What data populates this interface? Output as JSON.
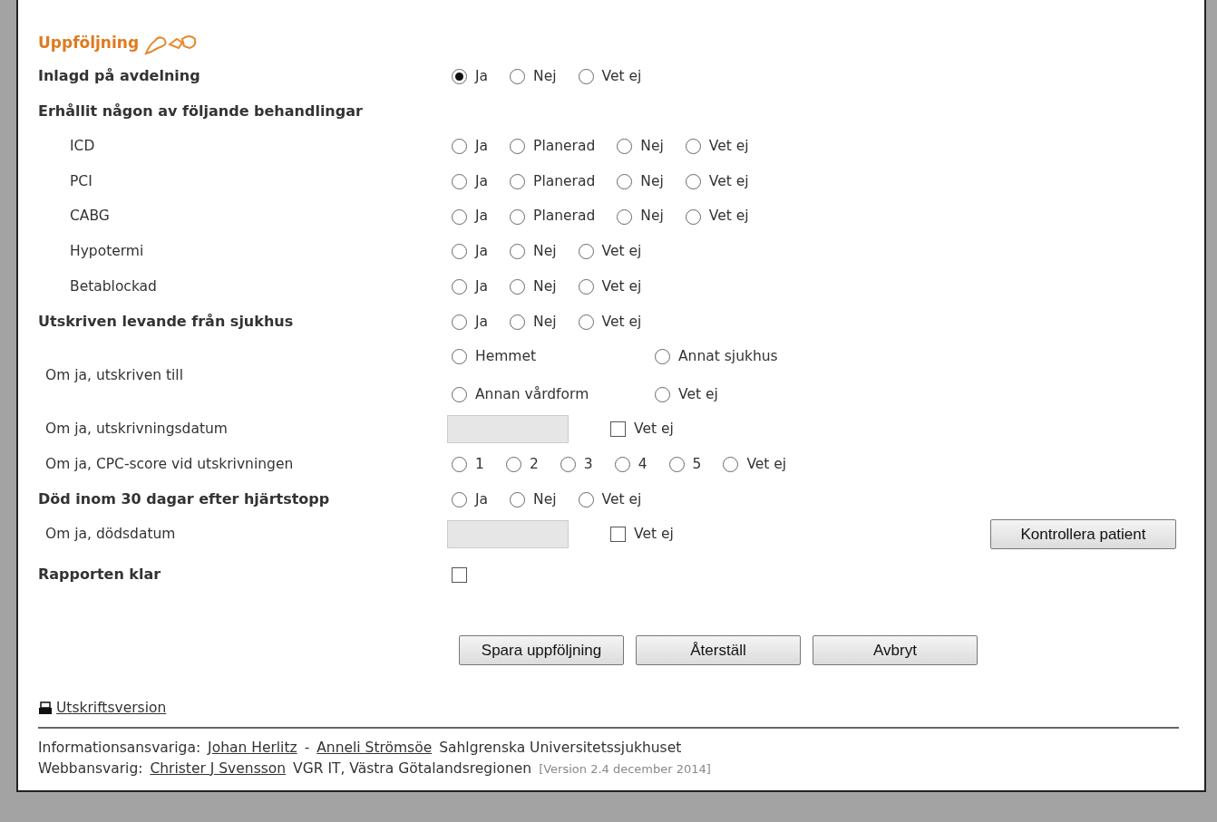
{
  "title": "Uppföljning",
  "questions": [
    {
      "kind": "radio",
      "label": "Inlagd på avdelning",
      "options": [
        {
          "label": "Ja",
          "selected": true
        },
        {
          "label": "Nej",
          "selected": false
        },
        {
          "label": "Vet ej",
          "selected": false
        }
      ]
    },
    {
      "kind": "section",
      "label": "Erhållit någon av följande behandlingar",
      "children": [
        {
          "kind": "radio",
          "label": "ICD",
          "options": [
            {
              "label": "Ja",
              "selected": false
            },
            {
              "label": "Planerad",
              "selected": false
            },
            {
              "label": "Nej",
              "selected": false
            },
            {
              "label": "Vet ej",
              "selected": false
            }
          ]
        },
        {
          "kind": "radio",
          "label": "PCI",
          "options": [
            {
              "label": "Ja",
              "selected": false
            },
            {
              "label": "Planerad",
              "selected": false
            },
            {
              "label": "Nej",
              "selected": false
            },
            {
              "label": "Vet ej",
              "selected": false
            }
          ]
        },
        {
          "kind": "radio",
          "label": "CABG",
          "options": [
            {
              "label": "Ja",
              "selected": false
            },
            {
              "label": "Planerad",
              "selected": false
            },
            {
              "label": "Nej",
              "selected": false
            },
            {
              "label": "Vet ej",
              "selected": false
            }
          ]
        },
        {
          "kind": "radio",
          "label": "Hypotermi",
          "options": [
            {
              "label": "Ja",
              "selected": false
            },
            {
              "label": "Nej",
              "selected": false
            },
            {
              "label": "Vet ej",
              "selected": false
            }
          ]
        },
        {
          "kind": "radio",
          "label": "Betablockad",
          "options": [
            {
              "label": "Ja",
              "selected": false
            },
            {
              "label": "Nej",
              "selected": false
            },
            {
              "label": "Vet ej",
              "selected": false
            }
          ]
        }
      ]
    },
    {
      "kind": "radio",
      "label": "Utskriven levande från sjukhus",
      "options": [
        {
          "label": "Ja",
          "selected": false
        },
        {
          "label": "Nej",
          "selected": false
        },
        {
          "label": "Vet ej",
          "selected": false
        }
      ],
      "children": [
        {
          "kind": "grid",
          "label": "Om ja, utskriven till",
          "options": [
            {
              "label": "Hemmet",
              "selected": false
            },
            {
              "label": "Annat sjukhus",
              "selected": false
            },
            {
              "label": "Annan vårdform",
              "selected": false
            },
            {
              "label": "Vet ej",
              "selected": false
            }
          ]
        },
        {
          "kind": "date",
          "label": "Om ja, utskrivningsdatum",
          "unknown": {
            "label": "Vet ej",
            "checked": false
          }
        },
        {
          "kind": "radio",
          "label": "Om ja, CPC-score vid utskrivningen",
          "options": [
            {
              "label": "1",
              "selected": false
            },
            {
              "label": "2",
              "selected": false
            },
            {
              "label": "3",
              "selected": false
            },
            {
              "label": "4",
              "selected": false
            },
            {
              "label": "5",
              "selected": false
            },
            {
              "label": "Vet ej",
              "selected": false
            }
          ]
        }
      ]
    },
    {
      "kind": "radio",
      "label": "Död inom 30 dagar efter hjärtstopp",
      "options": [
        {
          "label": "Ja",
          "selected": false
        },
        {
          "label": "Nej",
          "selected": false
        },
        {
          "label": "Vet ej",
          "selected": false
        }
      ],
      "children": [
        {
          "kind": "date",
          "label": "Om ja, dödsdatum",
          "unknown": {
            "label": "Vet ej",
            "checked": false
          },
          "button": "Kontrollera patient"
        }
      ]
    },
    {
      "kind": "check",
      "label": "Rapporten klar",
      "checked": false
    }
  ],
  "buttons": [
    "Spara uppföljning",
    "Återställ",
    "Avbryt"
  ],
  "print_link": "Utskriftsversion",
  "footer": [
    {
      "parts": [
        {
          "kind": "text",
          "text": "Informationsansvariga:"
        },
        {
          "kind": "link",
          "text": "Johan Herlitz"
        },
        {
          "kind": "text",
          "text": "-"
        },
        {
          "kind": "link",
          "text": "Anneli Strömsöe"
        },
        {
          "kind": "text",
          "text": "Sahlgrenska Universitetssjukhuset"
        }
      ]
    },
    {
      "parts": [
        {
          "kind": "text",
          "text": "Webbansvarig:"
        },
        {
          "kind": "link",
          "text": "Christer J Svensson"
        },
        {
          "kind": "text",
          "text": "VGR IT, Västra Götalandsregionen"
        },
        {
          "kind": "version",
          "text": "[Version 2.4 december 2014]"
        }
      ]
    }
  ]
}
